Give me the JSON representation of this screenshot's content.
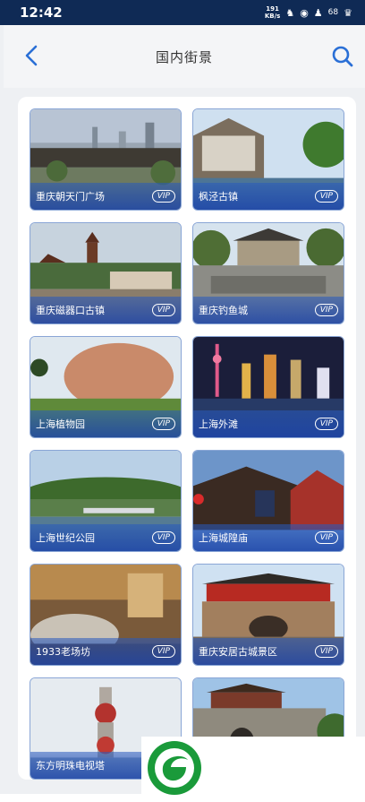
{
  "status_bar": {
    "time": "12:42",
    "net_speed_value": "191",
    "net_speed_unit": "KB/s",
    "battery_level": "68"
  },
  "header": {
    "title": "国内街景",
    "back_icon": "chevron-left-icon",
    "search_icon": "search-icon"
  },
  "tiles": [
    {
      "name": "重庆朝天门广场",
      "badge": "VIP",
      "scene": "plaza"
    },
    {
      "name": "枫泾古镇",
      "badge": "VIP",
      "scene": "watertown"
    },
    {
      "name": "重庆磁器口古镇",
      "badge": "VIP",
      "scene": "pagoda"
    },
    {
      "name": "重庆钓鱼城",
      "badge": "VIP",
      "scene": "gate"
    },
    {
      "name": "上海植物园",
      "badge": "VIP",
      "scene": "rock"
    },
    {
      "name": "上海外滩",
      "badge": "VIP",
      "scene": "skyline"
    },
    {
      "name": "上海世纪公园",
      "badge": "VIP",
      "scene": "park"
    },
    {
      "name": "上海城隍庙",
      "badge": "VIP",
      "scene": "temple"
    },
    {
      "name": "1933老场坊",
      "badge": "VIP",
      "scene": "interior"
    },
    {
      "name": "重庆安居古城景区",
      "badge": "VIP",
      "scene": "oldcity"
    },
    {
      "name": "东方明珠电视塔",
      "badge": "",
      "scene": "tower"
    },
    {
      "name": "",
      "badge": "",
      "scene": "citygate"
    }
  ],
  "colors": {
    "status_bar_bg": "#0f2a55",
    "accent_blue": "#2a6fd6",
    "tile_label_bg": "#2a5ab8",
    "logo_green": "#1a9a3a"
  }
}
